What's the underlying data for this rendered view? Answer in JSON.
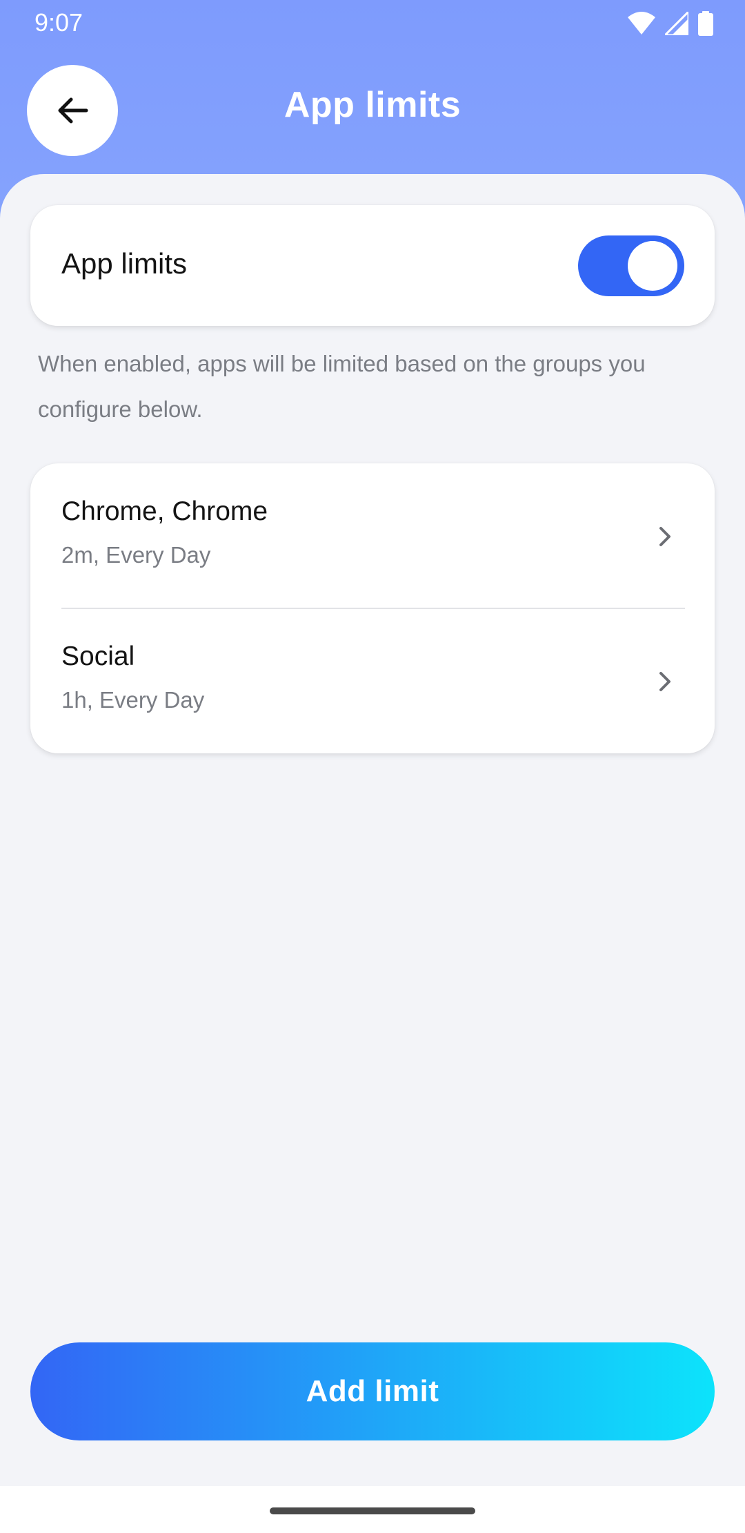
{
  "status_bar": {
    "time": "9:07",
    "icons": [
      "wifi-icon",
      "signal-icon",
      "battery-icon"
    ]
  },
  "header": {
    "title": "App limits",
    "back_icon": "arrow-left-icon"
  },
  "master_toggle": {
    "label": "App limits",
    "enabled": true
  },
  "description": "When enabled, apps will be limited based on the groups you configure below.",
  "limit_groups": [
    {
      "name": "Chrome, Chrome",
      "detail": "2m, Every Day",
      "icon": "chevron-right-icon"
    },
    {
      "name": "Social",
      "detail": "1h, Every Day",
      "icon": "chevron-right-icon"
    }
  ],
  "add_button": {
    "label": "Add limit"
  },
  "colors": {
    "header": "#7e9bfd",
    "accent": "#3366f5",
    "gradient_end": "#0ce3fb",
    "background": "#f3f4f8"
  }
}
